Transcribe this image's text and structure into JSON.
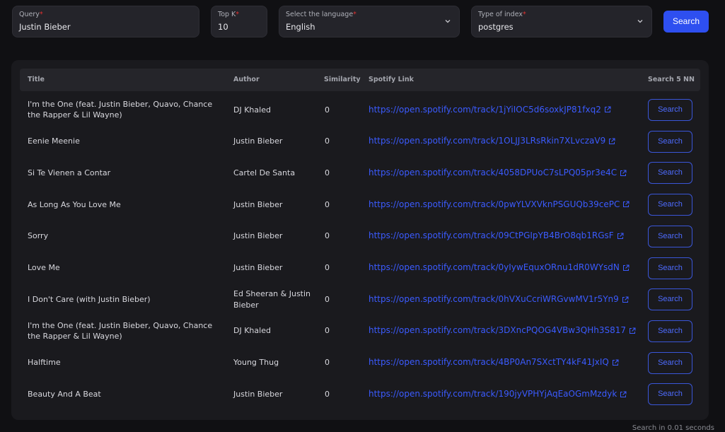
{
  "form": {
    "query": {
      "label": "Query",
      "value": "Justin Bieber"
    },
    "topk": {
      "label": "Top K",
      "value": "10"
    },
    "language": {
      "label": "Select the language",
      "value": "English"
    },
    "index": {
      "label": "Type of index",
      "value": "postgres"
    },
    "search_label": "Search",
    "required_mark": "*"
  },
  "table": {
    "headers": {
      "title": "Title",
      "author": "Author",
      "similarity": "Similarity",
      "link": "Spotify Link",
      "search_nn": "Search 5 NN"
    },
    "rows": [
      {
        "title": "I'm the One (feat. Justin Bieber, Quavo, Chance the Rapper & Lil Wayne)",
        "author": "DJ Khaled",
        "similarity": "0",
        "link": "https://open.spotify.com/track/1jYiIOC5d6soxkJP81fxq2",
        "button": "Search"
      },
      {
        "title": "Eenie Meenie",
        "author": "Justin Bieber",
        "similarity": "0",
        "link": "https://open.spotify.com/track/1OLJJ3LRsRkin7XLvczaV9",
        "button": "Search"
      },
      {
        "title": "Si Te Vienen a Contar",
        "author": "Cartel De Santa",
        "similarity": "0",
        "link": "https://open.spotify.com/track/4058DPUoC7sLPQ05pr3e4C",
        "button": "Search"
      },
      {
        "title": "As Long As You Love Me",
        "author": "Justin Bieber",
        "similarity": "0",
        "link": "https://open.spotify.com/track/0pwYLVXVknPSGUQb39cePC",
        "button": "Search"
      },
      {
        "title": "Sorry",
        "author": "Justin Bieber",
        "similarity": "0",
        "link": "https://open.spotify.com/track/09CtPGIpYB4BrO8qb1RGsF",
        "button": "Search"
      },
      {
        "title": "Love Me",
        "author": "Justin Bieber",
        "similarity": "0",
        "link": "https://open.spotify.com/track/0yIywEquxORnu1dR0WYsdN",
        "button": "Search"
      },
      {
        "title": "I Don't Care (with Justin Bieber)",
        "author": "Ed Sheeran & Justin Bieber",
        "similarity": "0",
        "link": "https://open.spotify.com/track/0hVXuCcriWRGvwMV1r5Yn9",
        "button": "Search"
      },
      {
        "title": "I'm the One (feat. Justin Bieber, Quavo, Chance the Rapper & Lil Wayne)",
        "author": "DJ Khaled",
        "similarity": "0",
        "link": "https://open.spotify.com/track/3DXncPQOG4VBw3QHh3S817",
        "button": "Search"
      },
      {
        "title": "Halftime",
        "author": "Young Thug",
        "similarity": "0",
        "link": "https://open.spotify.com/track/4BP0An7SXctTY4kF41JxIQ",
        "button": "Search"
      },
      {
        "title": "Beauty And A Beat",
        "author": "Justin Bieber",
        "similarity": "0",
        "link": "https://open.spotify.com/track/190jyVPHYjAqEaOGmMzdyk",
        "button": "Search"
      }
    ]
  },
  "footer": {
    "text": "Search in 0.01 seconds"
  },
  "icons": {
    "dropdown": "chevron-down-icon",
    "external_link": "external-link-icon"
  },
  "colors": {
    "accent": "#2e4ff0",
    "link": "#3b5bff",
    "required": "#e03131"
  }
}
